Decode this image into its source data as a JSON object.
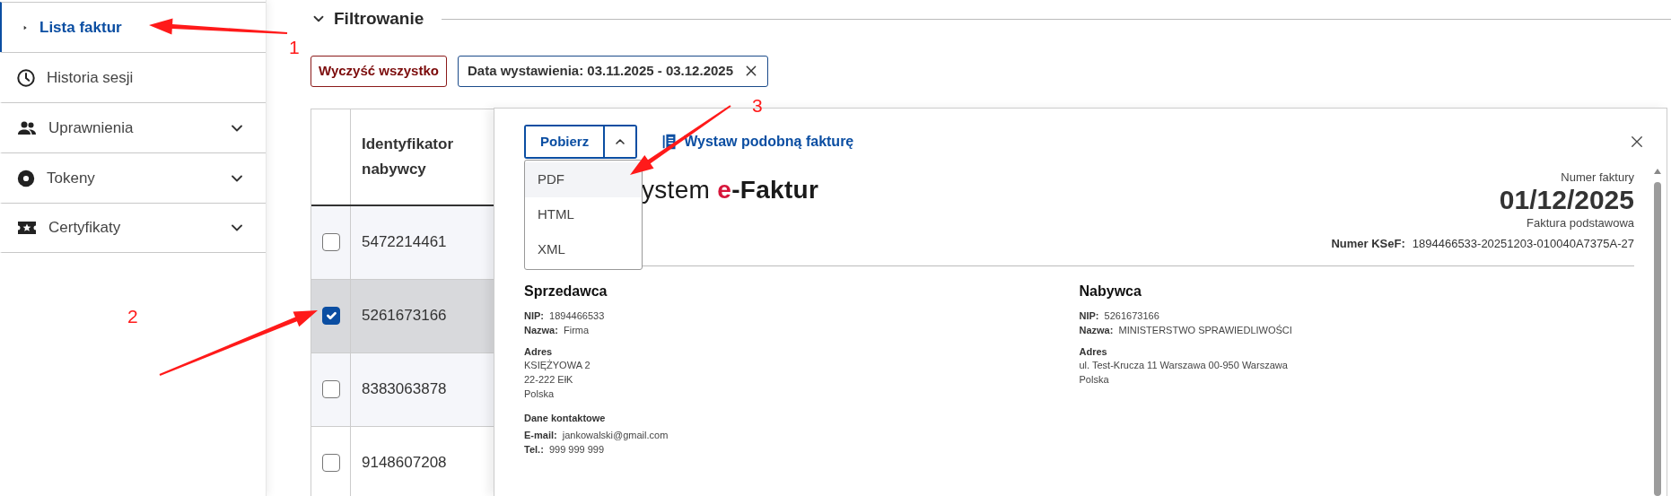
{
  "sidebar": {
    "items": [
      {
        "label": "Lista faktur",
        "selected": true,
        "expandable": false
      },
      {
        "label": "Historia sesji",
        "selected": false,
        "expandable": false
      },
      {
        "label": "Uprawnienia",
        "selected": false,
        "expandable": true
      },
      {
        "label": "Tokeny",
        "selected": false,
        "expandable": true
      },
      {
        "label": "Certyfikaty",
        "selected": false,
        "expandable": true
      }
    ]
  },
  "filter": {
    "title": "Filtrowanie",
    "expanded": true,
    "clear_label": "Wyczyść wszystko",
    "chips": [
      {
        "label": "Data wystawienia: 03.11.2025 - 03.12.2025"
      }
    ]
  },
  "table": {
    "columns": [
      "Identyfikator nabywcy"
    ],
    "rows": [
      {
        "id": "5472214461",
        "checked": false,
        "selected": false
      },
      {
        "id": "5261673166",
        "checked": true,
        "selected": true
      },
      {
        "id": "8383063878",
        "checked": false,
        "selected": false
      },
      {
        "id": "9148607208",
        "checked": false,
        "selected": false
      }
    ]
  },
  "drawer": {
    "download": {
      "label": "Pobierz",
      "expanded": true,
      "options": [
        {
          "label": "PDF",
          "selected": true
        },
        {
          "label": "HTML",
          "selected": false
        },
        {
          "label": "XML",
          "selected": false
        }
      ]
    },
    "similar_link": "Wystaw podobną fakturę",
    "logo": {
      "prefix": "ystem ",
      "accent": "e",
      "rest": "-Faktur"
    },
    "invoice_number_label": "Numer faktury",
    "invoice_number": "01/12/2025",
    "invoice_type": "Faktura podstawowa",
    "ksef_label": "Numer KSeF:",
    "ksef_value": "1894466533-20251203-010040A7375A-27",
    "parties": [
      {
        "title": "Sprzedawca",
        "fields": [
          {
            "label": "NIP:",
            "value": "1894466533"
          },
          {
            "label": "Nazwa:",
            "value": "Firma"
          }
        ],
        "address_title": "Adres",
        "address_lines": [
          "KSIĘŻYOWA 2",
          "22-222 EłK",
          "Polska"
        ],
        "contact_title": "Dane kontaktowe",
        "contact": [
          {
            "label": "E-mail:",
            "value": "jankowalski@gmail.com"
          },
          {
            "label": "Tel.:",
            "value": "999 999 999"
          }
        ]
      },
      {
        "title": "Nabywca",
        "fields": [
          {
            "label": "NIP:",
            "value": "5261673166"
          },
          {
            "label": "Nazwa:",
            "value": "MINISTERSTWO SPRAWIEDLIWOŚCI"
          }
        ],
        "address_title": "Adres",
        "address_lines": [
          "ul. Test-Krucza 11 Warszawa 00-950 Warszawa",
          "Polska"
        ]
      }
    ]
  },
  "annotations": [
    {
      "label": "1"
    },
    {
      "label": "2"
    },
    {
      "label": "3"
    }
  ]
}
